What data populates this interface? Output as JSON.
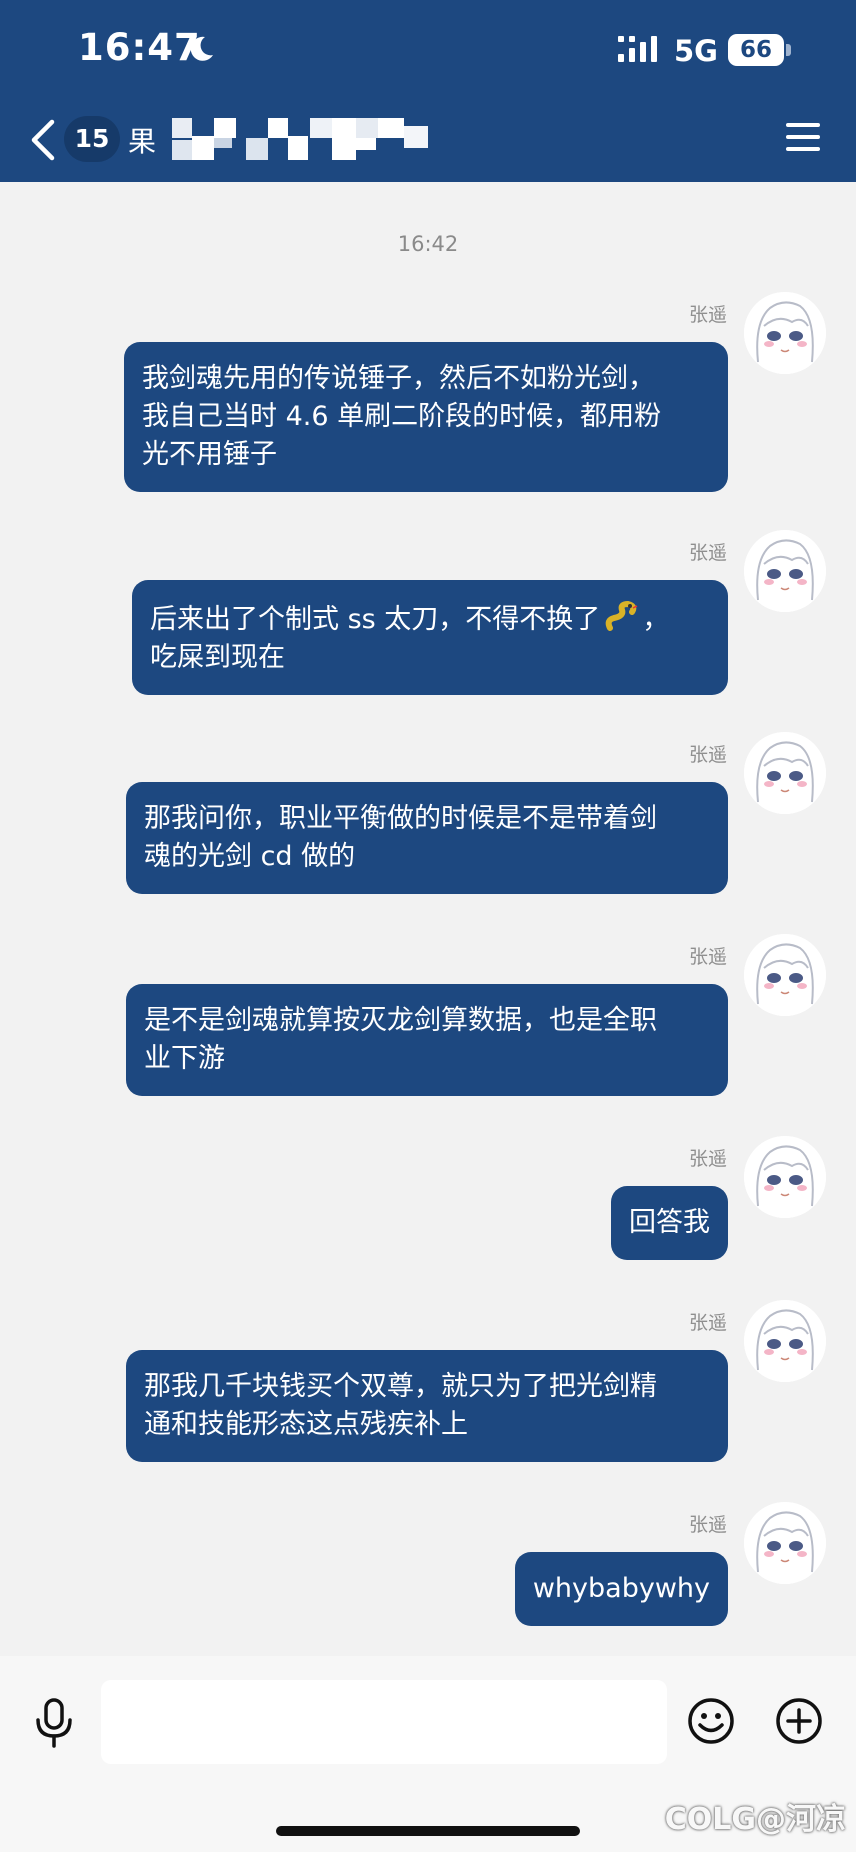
{
  "status_bar": {
    "time": "16:47",
    "network": "5G",
    "battery": "66"
  },
  "header": {
    "unread_count": "15",
    "title": "果",
    "accent_color": "#1d4880"
  },
  "chat": {
    "timestamp": "16:42",
    "messages": [
      {
        "sender": "张遥",
        "lines": [
          "我剑魂先用的传说锤子，然后不如粉光剑，",
          "我自己当时 4.6 单刷二阶段的时候，都用粉",
          "光不用锤子"
        ]
      },
      {
        "sender": "张遥",
        "lines": [
          "后来出了个制式 ss 太刀，不得不换了",
          "吃屎到现在"
        ],
        "emoji_after_line_1": "snake-emoji",
        "suffix_1": "，"
      },
      {
        "sender": "张遥",
        "lines": [
          "那我问你，职业平衡做的时候是不是带着剑",
          "魂的光剑 cd 做的"
        ]
      },
      {
        "sender": "张遥",
        "lines": [
          "是不是剑魂就算按灭龙剑算数据，也是全职",
          "业下游"
        ]
      },
      {
        "sender": "张遥",
        "lines": [
          "回答我"
        ]
      },
      {
        "sender": "张遥",
        "lines": [
          "那我几千块钱买个双尊，就只为了把光剑精",
          "通和技能形态这点残疾补上"
        ]
      },
      {
        "sender": "张遥",
        "lines": [
          "whybabywhy"
        ]
      }
    ]
  },
  "input_bar": {
    "value": "",
    "placeholder": "",
    "icons": [
      "microphone-icon",
      "emoji-icon",
      "plus-icon"
    ]
  },
  "watermark": "COLG@河凉"
}
